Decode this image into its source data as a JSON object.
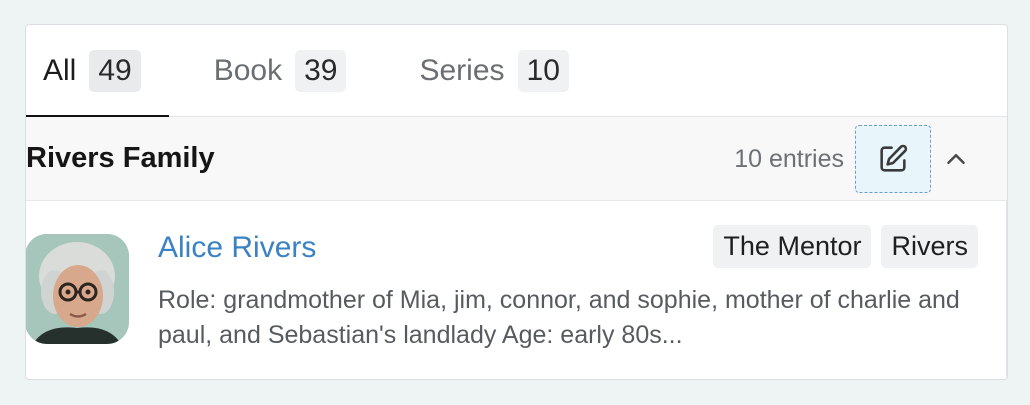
{
  "tabs": [
    {
      "label": "All",
      "count": "49",
      "active": true
    },
    {
      "label": "Book",
      "count": "39",
      "active": false
    },
    {
      "label": "Series",
      "count": "10",
      "active": false
    }
  ],
  "group": {
    "title": "Rivers Family",
    "entries_label": "10 entries",
    "edit_icon": "edit-pencil-icon",
    "collapse_icon": "chevron-up-icon"
  },
  "entry": {
    "name": "Alice Rivers",
    "tags": [
      "The Mentor",
      "Rivers"
    ],
    "description": "Role: grandmother of Mia, jim, connor, and sophie, mother of charlie and paul, and Sebastian's landlady Age: early 80s..."
  },
  "colors": {
    "link": "#3b82c4",
    "active_underline": "#111111",
    "edit_bg": "#e8f5fb",
    "edit_border": "#6f9fc0"
  }
}
